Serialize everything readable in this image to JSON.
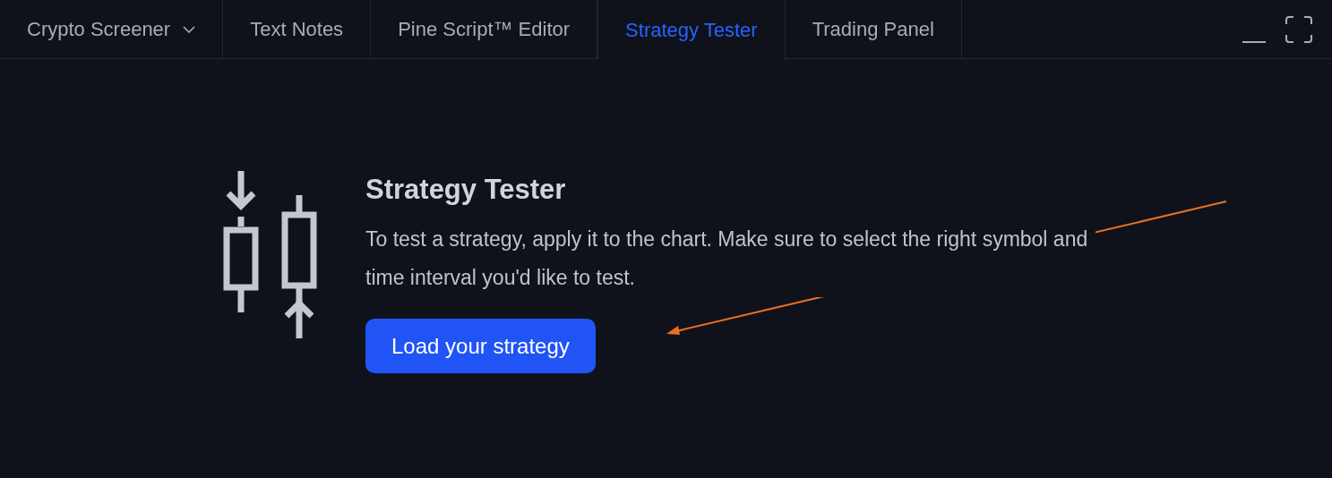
{
  "tabs": [
    {
      "label": "Crypto Screener",
      "selected": false,
      "dropdown": true
    },
    {
      "label": "Text Notes",
      "selected": false,
      "dropdown": false
    },
    {
      "label": "Pine Script™ Editor",
      "selected": false,
      "dropdown": false
    },
    {
      "label": "Strategy Tester",
      "selected": true,
      "dropdown": false
    },
    {
      "label": "Trading Panel",
      "selected": false,
      "dropdown": false
    }
  ],
  "empty_state": {
    "title": "Strategy Tester",
    "message": "To test a strategy, apply it to the chart. Make sure to select the right symbol and time interval you'd like to test.",
    "button": "Load your strategy"
  }
}
